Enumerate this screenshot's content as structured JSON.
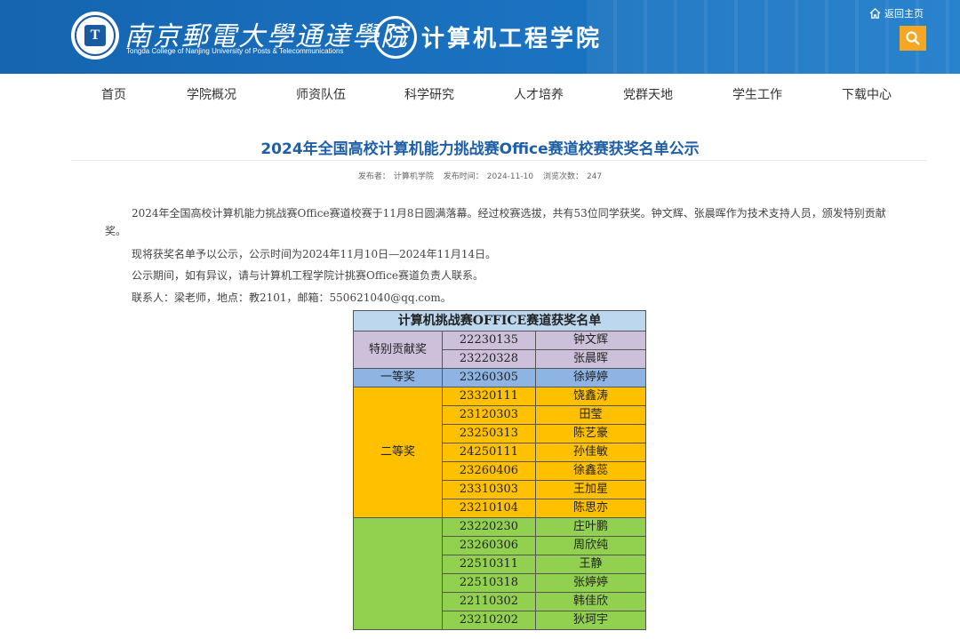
{
  "header": {
    "school_name_cn": "南京郵電大學通達學院",
    "school_name_en": "Tongda College of Nanjing University of Posts & Telecommunications",
    "college_name": "计算机工程学院",
    "home_link": "返回主页",
    "search_icon": "search-icon",
    "home_icon": "home-icon",
    "colors": {
      "header_bg": "#1a6fbf",
      "search_bg": "#f5a623",
      "title": "#1f5fa8"
    }
  },
  "nav": {
    "items": [
      "首页",
      "学院概况",
      "师资队伍",
      "科学研究",
      "人才培养",
      "党群天地",
      "学生工作",
      "下载中心"
    ]
  },
  "article": {
    "title": "2024年全国高校计算机能力挑战赛Office赛道校赛获奖名单公示",
    "meta": {
      "publisher_label": "发布者：",
      "publisher": "计算机学院",
      "date_label": "发布时间：",
      "date": "2024-11-10",
      "views_label": "浏览次数：",
      "views": "247"
    },
    "paragraphs": [
      "2024年全国高校计算机能力挑战赛Office赛道校赛于11月8日圆满落幕。经过校赛选拔，共有53位同学获奖。钟文辉、张晨晖作为技术支持人员，颁发特别贡献奖。",
      "现将获奖名单予以公示，公示时间为2024年11月10日—2024年11月14日。",
      "公示期间，如有异议，请与计算机工程学院计挑赛Office赛道负责人联系。",
      "联系人：梁老师，地点：教2101，邮箱：550621040@qq.com。"
    ]
  },
  "award_table": {
    "title": "计算机挑战赛OFFICE赛道获奖名单",
    "groups": [
      {
        "award": "特别贡献奖",
        "color": "#ccc0da",
        "rows": [
          [
            "22230135",
            "钟文辉"
          ],
          [
            "23220328",
            "张晨晖"
          ]
        ]
      },
      {
        "award": "一等奖",
        "color": "#8db4e2",
        "rows": [
          [
            "23260305",
            "徐婷婷"
          ]
        ]
      },
      {
        "award": "二等奖",
        "color": "#ffc000",
        "rows": [
          [
            "23320111",
            "饶鑫涛"
          ],
          [
            "23120303",
            "田莹"
          ],
          [
            "23250313",
            "陈艺豪"
          ],
          [
            "24250111",
            "孙佳敏"
          ],
          [
            "23260406",
            "徐鑫蕊"
          ],
          [
            "23310303",
            "王加星"
          ],
          [
            "23210104",
            "陈思亦"
          ]
        ]
      },
      {
        "award": "",
        "color": "#92d050",
        "rows": [
          [
            "23220230",
            "庄叶鹏"
          ],
          [
            "23260306",
            "周欣纯"
          ],
          [
            "22510311",
            "王静"
          ],
          [
            "22510318",
            "张婷婷"
          ],
          [
            "22110302",
            "韩佳欣"
          ],
          [
            "23210202",
            "狄珂宇"
          ]
        ]
      }
    ]
  }
}
